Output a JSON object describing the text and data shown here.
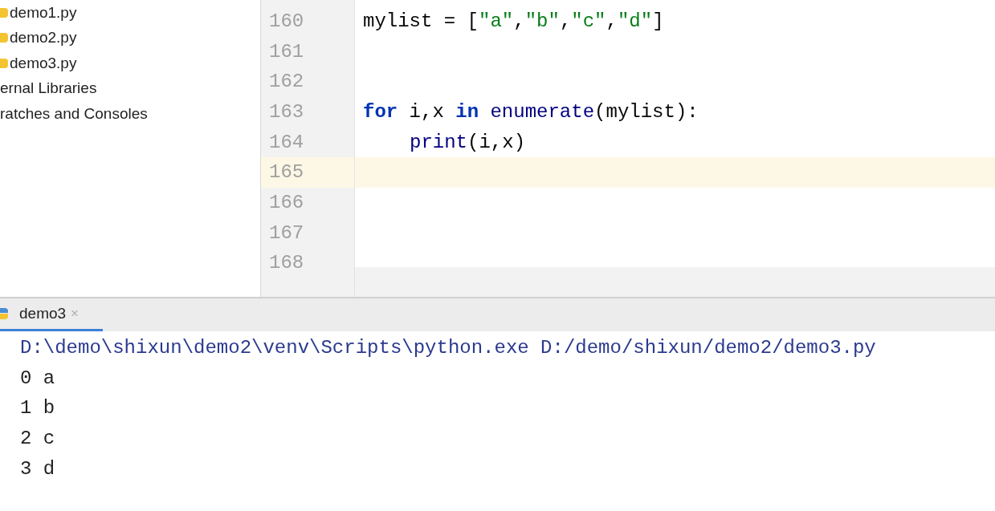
{
  "project_tree": {
    "items": [
      {
        "label": "demo1.py",
        "kind": "file"
      },
      {
        "label": "demo2.py",
        "kind": "file"
      },
      {
        "label": "demo3.py",
        "kind": "file"
      },
      {
        "label": "ernal Libraries",
        "kind": "folder"
      },
      {
        "label": "ratches and Consoles",
        "kind": "folder"
      }
    ]
  },
  "editor": {
    "lines": [
      {
        "number": "160",
        "current": false,
        "tokens": [
          {
            "kind": "plain",
            "text": "mylist = ["
          },
          {
            "kind": "string",
            "text": "\"a\""
          },
          {
            "kind": "plain",
            "text": ","
          },
          {
            "kind": "string",
            "text": "\"b\""
          },
          {
            "kind": "plain",
            "text": ","
          },
          {
            "kind": "string",
            "text": "\"c\""
          },
          {
            "kind": "plain",
            "text": ","
          },
          {
            "kind": "string",
            "text": "\"d\""
          },
          {
            "kind": "plain",
            "text": "]"
          }
        ]
      },
      {
        "number": "161",
        "current": false
      },
      {
        "number": "162",
        "current": false
      },
      {
        "number": "163",
        "current": false,
        "tokens": [
          {
            "kind": "keyword",
            "text": "for"
          },
          {
            "kind": "plain",
            "text": " i,x "
          },
          {
            "kind": "keyword",
            "text": "in "
          },
          {
            "kind": "builtin",
            "text": "enumerate"
          },
          {
            "kind": "plain",
            "text": "(mylist):"
          }
        ]
      },
      {
        "number": "164",
        "current": false,
        "indented": true,
        "tokens": [
          {
            "kind": "builtin",
            "text": "print"
          },
          {
            "kind": "plain",
            "text": "(i,x)"
          }
        ]
      },
      {
        "number": "165",
        "current": true
      },
      {
        "number": "166",
        "current": false
      },
      {
        "number": "167",
        "current": false
      },
      {
        "number": "168",
        "current": false
      }
    ]
  },
  "run_panel": {
    "tabs": [
      {
        "label": "demo3",
        "selected": true,
        "close": "×"
      }
    ],
    "output": [
      {
        "kind": "command",
        "text": "D:\\demo\\shixun\\demo2\\venv\\Scripts\\python.exe D:/demo/shixun/demo2/demo3.py"
      },
      {
        "kind": "stdout",
        "text": "0 a"
      },
      {
        "kind": "stdout",
        "text": "1 b"
      },
      {
        "kind": "stdout",
        "text": "2 c"
      },
      {
        "kind": "stdout",
        "text": "3 d"
      }
    ]
  }
}
